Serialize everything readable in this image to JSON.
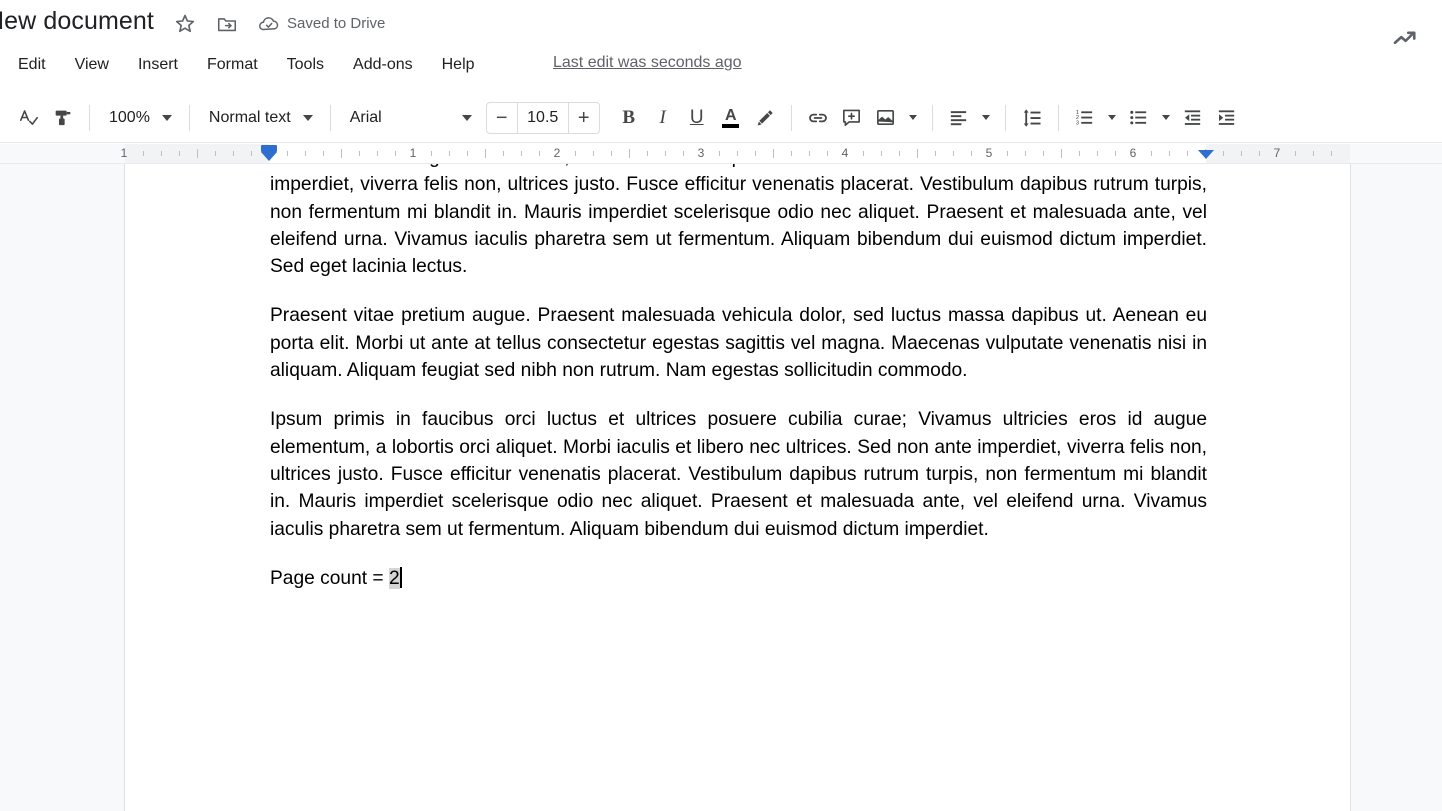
{
  "window": {
    "app": "Google Docs"
  },
  "titlebar": {
    "doc_title": "New document",
    "saved_status": "Saved to Drive",
    "icons": {
      "star": "star-icon",
      "move_to_folder": "move-to-folder-icon",
      "cloud_saved": "cloud-saved-icon",
      "activity": "trending-up-icon"
    }
  },
  "menubar": {
    "items": [
      {
        "label": "Edit"
      },
      {
        "label": "View"
      },
      {
        "label": "Insert"
      },
      {
        "label": "Format"
      },
      {
        "label": "Tools"
      },
      {
        "label": "Add-ons"
      },
      {
        "label": "Help"
      }
    ],
    "last_edit": "Last edit was seconds ago"
  },
  "toolbar": {
    "spellcheck_label": "spellcheck-icon",
    "paint_format_label": "paint-format-icon",
    "zoom_value": "100%",
    "style_value": "Normal text",
    "font_value": "Arial",
    "font_size_value": "10.5",
    "font_size_minus": "−",
    "font_size_plus": "+",
    "bold_label": "B",
    "italic_label": "I",
    "underline_label": "U",
    "text_color_label": "A",
    "text_color_hex": "#000000",
    "highlight_label": "highlight-color-icon",
    "link_label": "insert-link-icon",
    "comment_label": "add-comment-icon",
    "image_label": "insert-image-icon",
    "align_label": "align-icon",
    "line_spacing_label": "line-spacing-icon",
    "numbered_list_label": "numbered-list-icon",
    "bulleted_list_label": "bulleted-list-icon",
    "decrease_indent_label": "decrease-indent-icon",
    "increase_indent_label": "increase-indent-icon"
  },
  "ruler": {
    "numbers": [
      "1",
      "1",
      "2",
      "3",
      "4",
      "5",
      "6",
      "7"
    ],
    "left_indent_marker": "left-indent-marker",
    "right_indent_marker": "right-indent-marker",
    "marker_color": "#2d6ecf"
  },
  "document": {
    "paragraphs": [
      "ultrices eros id augue elementum, a lobortis orci aliquet. Morbi iaculis et libero nec ultrices. Sed non ante imperdiet, viverra felis non, ultrices justo. Fusce efficitur venenatis placerat. Vestibulum dapibus rutrum turpis, non fermentum mi blandit in. Mauris imperdiet scelerisque odio nec aliquet. Praesent et malesuada ante, vel eleifend urna. Vivamus iaculis pharetra sem ut fermentum. Aliquam bibendum dui euismod dictum imperdiet. Sed eget lacinia lectus.",
      "Praesent vitae pretium augue. Praesent malesuada vehicula dolor, sed luctus massa dapibus ut. Aenean eu porta elit. Morbi ut ante at tellus consectetur egestas sagittis vel magna. Maecenas vulputate venenatis nisi in aliquam. Aliquam feugiat sed nibh non rutrum. Nam egestas sollicitudin commodo.",
      "Ipsum primis in faucibus orci luctus et ultrices posuere cubilia curae; Vivamus ultricies eros id augue elementum, a lobortis orci aliquet. Morbi iaculis et libero nec ultrices. Sed non ante imperdiet, viverra felis non, ultrices justo. Fusce efficitur venenatis placerat. Vestibulum dapibus rutrum turpis, non fermentum mi blandit in. Mauris imperdiet scelerisque odio nec aliquet. Praesent et malesuada ante, vel eleifend urna. Vivamus iaculis pharetra sem ut fermentum. Aliquam bibendum dui euismod dictum imperdiet."
    ],
    "page_count_prefix": "Page count = ",
    "page_count_value": "2",
    "selection_color": "#d5d5d5"
  }
}
